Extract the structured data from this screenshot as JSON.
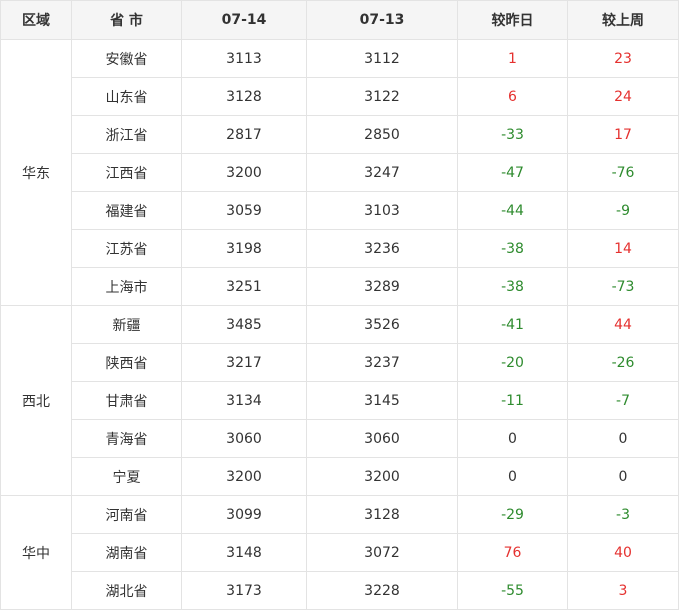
{
  "header": {
    "region": "区域",
    "province": "省 市",
    "date1": "07-14",
    "date2": "07-13",
    "vs_yesterday": "较昨日",
    "vs_last_week": "较上周"
  },
  "colors": {
    "up": "#e5312f",
    "down": "#2e8b2e",
    "flat": "#333333"
  },
  "groups": [
    {
      "region": "华东",
      "rows": [
        {
          "province": "安徽省",
          "d1": "3113",
          "d2": "3112",
          "day": "1",
          "week": "23"
        },
        {
          "province": "山东省",
          "d1": "3128",
          "d2": "3122",
          "day": "6",
          "week": "24"
        },
        {
          "province": "浙江省",
          "d1": "2817",
          "d2": "2850",
          "day": "-33",
          "week": "17"
        },
        {
          "province": "江西省",
          "d1": "3200",
          "d2": "3247",
          "day": "-47",
          "week": "-76"
        },
        {
          "province": "福建省",
          "d1": "3059",
          "d2": "3103",
          "day": "-44",
          "week": "-9"
        },
        {
          "province": "江苏省",
          "d1": "3198",
          "d2": "3236",
          "day": "-38",
          "week": "14"
        },
        {
          "province": "上海市",
          "d1": "3251",
          "d2": "3289",
          "day": "-38",
          "week": "-73"
        }
      ]
    },
    {
      "region": "西北",
      "rows": [
        {
          "province": "新疆",
          "d1": "3485",
          "d2": "3526",
          "day": "-41",
          "week": "44"
        },
        {
          "province": "陕西省",
          "d1": "3217",
          "d2": "3237",
          "day": "-20",
          "week": "-26"
        },
        {
          "province": "甘肃省",
          "d1": "3134",
          "d2": "3145",
          "day": "-11",
          "week": "-7"
        },
        {
          "province": "青海省",
          "d1": "3060",
          "d2": "3060",
          "day": "0",
          "week": "0"
        },
        {
          "province": "宁夏",
          "d1": "3200",
          "d2": "3200",
          "day": "0",
          "week": "0"
        }
      ]
    },
    {
      "region": "华中",
      "rows": [
        {
          "province": "河南省",
          "d1": "3099",
          "d2": "3128",
          "day": "-29",
          "week": "-3"
        },
        {
          "province": "湖南省",
          "d1": "3148",
          "d2": "3072",
          "day": "76",
          "week": "40"
        },
        {
          "province": "湖北省",
          "d1": "3173",
          "d2": "3228",
          "day": "-55",
          "week": "3"
        }
      ]
    }
  ]
}
